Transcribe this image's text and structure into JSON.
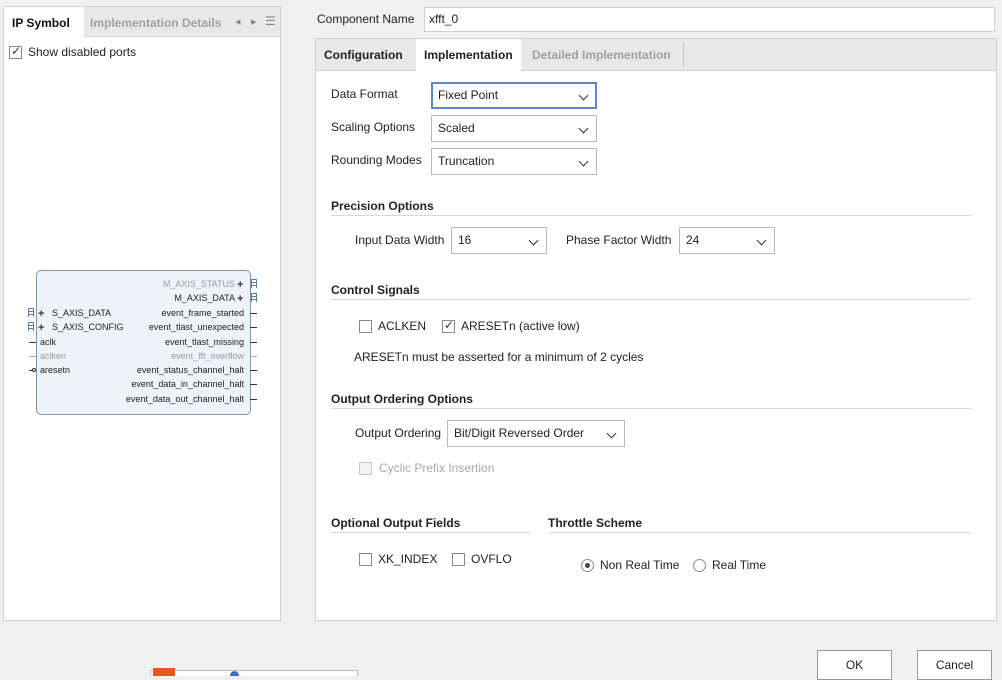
{
  "left_panel": {
    "tabs": [
      {
        "label": "IP Symbol",
        "active": true
      },
      {
        "label": "Implementation Details",
        "active": false
      }
    ],
    "show_disabled_ports": {
      "label": "Show disabled ports",
      "checked": true
    },
    "ip_symbol": {
      "right_ports": [
        {
          "name": "M_AXIS_STATUS",
          "bus": true,
          "dim": true
        },
        {
          "name": "M_AXIS_DATA",
          "bus": true,
          "dim": false
        },
        {
          "name": "event_frame_started",
          "dim": false
        },
        {
          "name": "event_tlast_unexpected",
          "dim": false
        },
        {
          "name": "event_tlast_missing",
          "dim": false
        },
        {
          "name": "event_fft_overflow",
          "dim": true
        },
        {
          "name": "event_status_channel_halt",
          "dim": false
        },
        {
          "name": "event_data_in_channel_halt",
          "dim": false
        },
        {
          "name": "event_data_out_channel_halt",
          "dim": false
        }
      ],
      "left_ports": [
        {
          "name": "S_AXIS_DATA",
          "bus": true,
          "dim": false
        },
        {
          "name": "S_AXIS_CONFIG",
          "bus": true,
          "dim": false
        },
        {
          "name": "aclk",
          "dim": false
        },
        {
          "name": "aclken",
          "dim": true
        },
        {
          "name": "aresetn",
          "dim": false,
          "active_low": true
        }
      ]
    }
  },
  "component": {
    "label": "Component Name",
    "value": "xfft_0"
  },
  "tabs": [
    {
      "label": "Configuration",
      "active": false
    },
    {
      "label": "Implementation",
      "active": true
    },
    {
      "label": "Detailed Implementation",
      "active": false,
      "dim": true
    }
  ],
  "impl": {
    "data_format": {
      "label": "Data Format",
      "value": "Fixed Point"
    },
    "scaling_options": {
      "label": "Scaling Options",
      "value": "Scaled"
    },
    "rounding_modes": {
      "label": "Rounding Modes",
      "value": "Truncation"
    },
    "precision": {
      "title": "Precision Options",
      "input_data_width": {
        "label": "Input Data Width",
        "value": "16"
      },
      "phase_factor_width": {
        "label": "Phase Factor Width",
        "value": "24"
      }
    },
    "control": {
      "title": "Control Signals",
      "aclken": {
        "label": "ACLKEN",
        "checked": false
      },
      "aresetn": {
        "label": "ARESETn (active low)",
        "checked": true
      },
      "note": "ARESETn must be asserted for a minimum of 2 cycles"
    },
    "output_ordering": {
      "title": "Output Ordering Options",
      "ordering": {
        "label": "Output Ordering",
        "value": "Bit/Digit Reversed Order"
      },
      "cyclic_prefix": {
        "label": "Cyclic Prefix Insertion",
        "checked": false,
        "disabled": true
      }
    },
    "optional_fields": {
      "title": "Optional Output Fields",
      "xk_index": {
        "label": "XK_INDEX",
        "checked": false
      },
      "ovflo": {
        "label": "OVFLO",
        "checked": false
      }
    },
    "throttle": {
      "title": "Throttle Scheme",
      "options": [
        {
          "label": "Non Real Time",
          "selected": true
        },
        {
          "label": "Real Time",
          "selected": false
        }
      ]
    }
  },
  "buttons": {
    "ok": "OK",
    "cancel": "Cancel"
  },
  "colors": {
    "focus_border": "#5a86c8",
    "ip_fill": "#eef3fa",
    "ip_border": "#7d96b8"
  }
}
